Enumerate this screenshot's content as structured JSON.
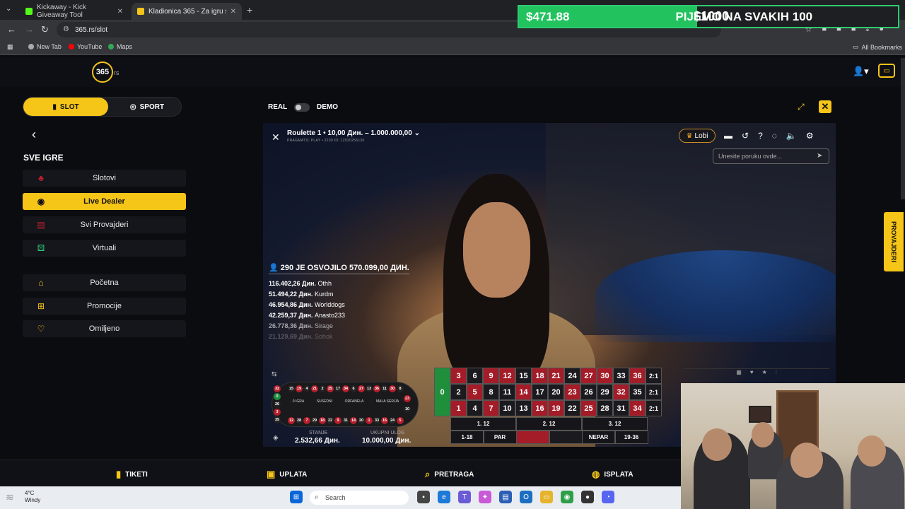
{
  "browser": {
    "tabs": [
      {
        "label": "Kickaway - Kick Giveaway Tool",
        "active": false
      },
      {
        "label": "Kladionica 365 - Za igru sa druge",
        "active": true
      }
    ],
    "url": "365.rs/slot",
    "bookmarks": [
      "New Tab",
      "YouTube",
      "Maps"
    ],
    "all_bookmarks": "All Bookmarks"
  },
  "overlay": {
    "amount": "$471.88",
    "text": "PIJEMO NA SVAKIH 100",
    "goal": "$1000",
    "progress": 0.47
  },
  "site": {
    "logo": "365",
    "logo_suffix": "rs"
  },
  "switch": {
    "slot": "SLOT",
    "sport": "SPORT"
  },
  "sidebar": {
    "section_title": "SVE IGRE",
    "items": [
      {
        "label": "Slotovi",
        "icon": "slot-icon",
        "active": false
      },
      {
        "label": "Live Dealer",
        "icon": "live-dealer-icon",
        "active": true
      },
      {
        "label": "Svi Provajderi",
        "icon": "providers-icon",
        "active": false
      },
      {
        "label": "Virtuali",
        "icon": "dice-icon",
        "active": false
      },
      {
        "label": "Početna",
        "icon": "home-icon",
        "active": false
      },
      {
        "label": "Promocije",
        "icon": "gift-icon",
        "active": false
      },
      {
        "label": "Omiljeno",
        "icon": "heart-icon",
        "active": false
      }
    ]
  },
  "game_bar": {
    "real": "REAL",
    "demo": "DEMO"
  },
  "game": {
    "title": "Roulette 1 • 10,00 Дин. – 1.000.000,00 ⌄",
    "subtitle": "PRAGMATIC PLAY • 2230 ID: 12520256130",
    "lobi": "Lobi",
    "chat_placeholder": "Unesite poruku ovde...",
    "winners_title": "290 JE OSVOJILO 570.099,00 ДИН.",
    "winners": [
      {
        "amount": "116.402,26 Дин.",
        "name": "Othh"
      },
      {
        "amount": "51.494,22 Дин.",
        "name": "Kurdm"
      },
      {
        "amount": "46.954,86 Дин.",
        "name": "Worlddogs"
      },
      {
        "amount": "42.259,37 Дин.",
        "name": "Anasto233"
      },
      {
        "amount": "26.778,36 Дин.",
        "name": "Sirage"
      },
      {
        "amount": "21.129,69 Дин.",
        "name": "Sohok"
      }
    ],
    "racetrack": {
      "top": [
        "15",
        "19",
        "4",
        "21",
        "2",
        "25",
        "17",
        "34",
        "6",
        "27",
        "13",
        "36",
        "11",
        "30",
        "8"
      ],
      "bottom": [
        "12",
        "28",
        "7",
        "29",
        "18",
        "22",
        "9",
        "31",
        "14",
        "20",
        "1",
        "33",
        "16",
        "24",
        "5"
      ],
      "left": [
        "32",
        "0",
        "26",
        "3",
        "35"
      ],
      "right": [
        "23",
        "10"
      ],
      "sections": [
        "0 IGRA",
        "SUSEDNI",
        "ORFANELA",
        "MALA SERIJA"
      ]
    },
    "balance_label": "STANJE",
    "balance_value": "2.532,66 Дин.",
    "total_bet_label": "UKUPNI ULOG",
    "total_bet_value": "10.000,00 Дин.",
    "grid": {
      "zero": "0",
      "rows": [
        [
          "3",
          "6",
          "9",
          "12",
          "15",
          "18",
          "21",
          "24",
          "27",
          "30",
          "33",
          "36"
        ],
        [
          "2",
          "5",
          "8",
          "11",
          "14",
          "17",
          "20",
          "23",
          "26",
          "29",
          "32",
          "35"
        ],
        [
          "1",
          "4",
          "7",
          "10",
          "13",
          "16",
          "19",
          "22",
          "25",
          "28",
          "31",
          "34"
        ]
      ],
      "red_numbers": [
        "1",
        "3",
        "5",
        "7",
        "9",
        "12",
        "14",
        "16",
        "18",
        "19",
        "21",
        "23",
        "25",
        "27",
        "30",
        "32",
        "34",
        "36"
      ],
      "column_label": "2:1",
      "dozens": [
        "1. 12",
        "2. 12",
        "3. 12"
      ],
      "outside": [
        "1-18",
        "PAR",
        "",
        "",
        "NEPAR",
        "19-36"
      ]
    }
  },
  "side_tab": "PROVAJDERI",
  "bottom_nav": [
    {
      "label": "TIKETI",
      "icon": "ticket-icon"
    },
    {
      "label": "UPLATA",
      "icon": "deposit-icon"
    },
    {
      "label": "PRETRAGA",
      "icon": "search-icon"
    },
    {
      "label": "ISPLATA",
      "icon": "coins-icon"
    }
  ],
  "taskbar": {
    "temp": "4°C",
    "weather": "Windy",
    "search": "Search"
  },
  "colors": {
    "accent": "#f5c518",
    "red": "#a31c28",
    "green": "#1f8f3c",
    "overlay_green": "#22c35e"
  }
}
